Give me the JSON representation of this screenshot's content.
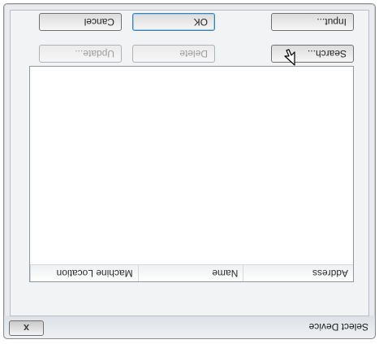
{
  "window": {
    "title": "Select Device",
    "close_glyph": "x"
  },
  "list": {
    "columns": [
      {
        "label": "Address"
      },
      {
        "label": "Name"
      },
      {
        "label": "Machine Location"
      }
    ],
    "rows": []
  },
  "buttons": {
    "search": "Search...",
    "delete": "Delete",
    "update": "Update...",
    "input": "Input...",
    "ok": "OK",
    "cancel": "Cancel"
  },
  "cursor_icon": "arrow-pointer-icon"
}
